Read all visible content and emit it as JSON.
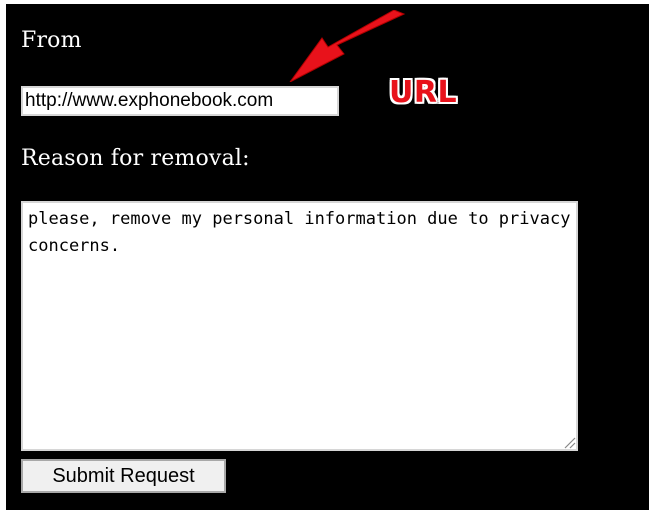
{
  "form": {
    "from_label": "From",
    "from_value": "http://www.exphonebook.com",
    "reason_label": "Reason for removal:",
    "reason_value": "please, remove my personal information due to privacy concerns.",
    "submit_label": "Submit Request"
  },
  "annotation": {
    "label": "URL",
    "color": "#e8121b",
    "icon": "red-arrow-icon"
  }
}
